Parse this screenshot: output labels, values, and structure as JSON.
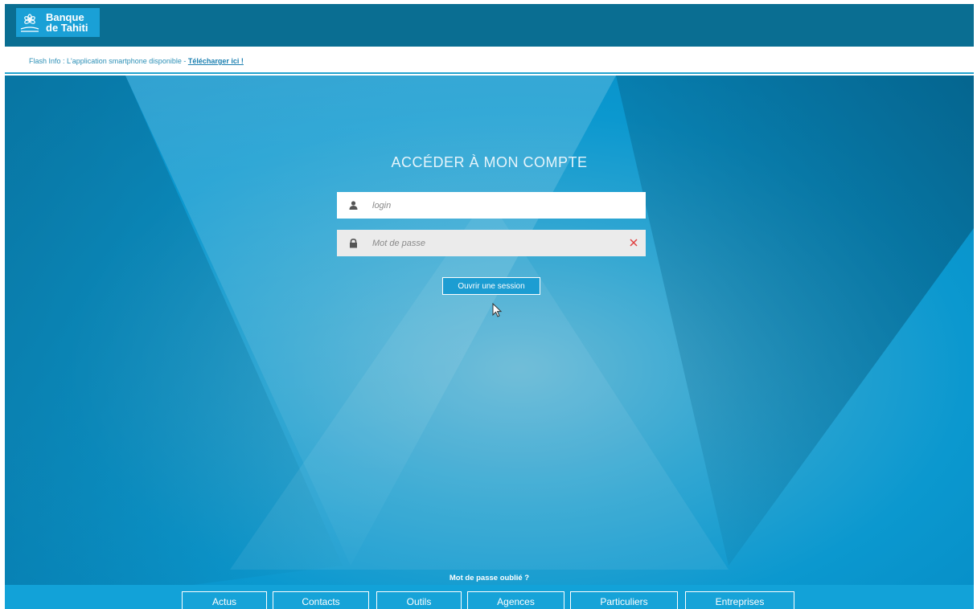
{
  "header": {
    "logo_text": "Banque\nde Tahiti",
    "logo_icon": "flower-icon"
  },
  "flash": {
    "text": "Flash Info : L'application smartphone disponible - ",
    "link": "Télécharger ici !"
  },
  "login": {
    "title": "ACCÉDER À MON COMPTE",
    "login_placeholder": "login",
    "login_value": "",
    "password_placeholder": "Mot de passe",
    "password_value": "",
    "submit_label": "Ouvrir une session",
    "forgot_label": "Mot de passe oublié ?"
  },
  "nav": {
    "items": [
      {
        "label": "Actus"
      },
      {
        "label": "Contacts"
      },
      {
        "label": "Outils"
      },
      {
        "label": "Agences"
      },
      {
        "label": "Particuliers"
      },
      {
        "label": "Entreprises"
      }
    ]
  },
  "colors": {
    "header_bg": "#0a6e92",
    "accent": "#1aa0d6",
    "clear_icon": "#e04040"
  }
}
